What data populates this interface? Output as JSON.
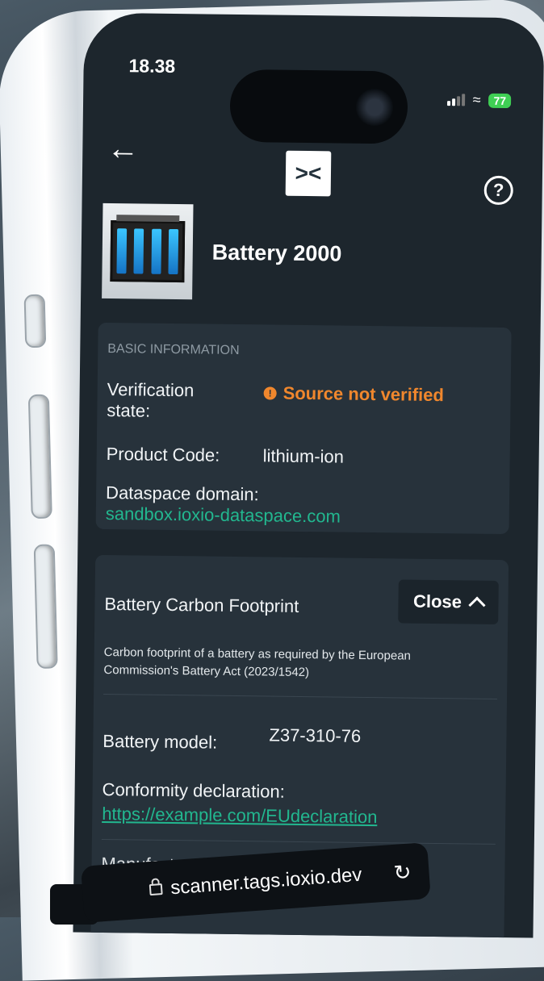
{
  "status": {
    "time": "18.38",
    "battery": "77"
  },
  "header": {
    "back_icon": "arrow-left-icon",
    "logo_text": "><",
    "help_icon": "question-circle-icon"
  },
  "product": {
    "name": "Battery 2000"
  },
  "basic": {
    "section_label": "BASIC INFORMATION",
    "verification_label_1": "Verification",
    "verification_label_2": "state:",
    "verification_value": "Source not verified",
    "product_code_label": "Product Code:",
    "product_code_value": "lithium-ion",
    "dataspace_label": "Dataspace domain:",
    "dataspace_value": "sandbox.ioxio-dataspace.com"
  },
  "carbon": {
    "title": "Battery Carbon Footprint",
    "close_label": "Close",
    "description": "Carbon footprint of a battery as required by the European Commission's Battery Act (2023/1542)",
    "model_label": "Battery model:",
    "model_value": "Z37-310-76",
    "conformity_label": "Conformity declaration:",
    "conformity_link": "https://example.com/EUdeclaration",
    "next_label_partial": "Manufacturer information:"
  },
  "browser": {
    "url": "scanner.tags.ioxio.dev"
  },
  "colors": {
    "accent_link": "#22b78f",
    "warning": "#f0872d",
    "card_bg": "#27323b",
    "screen_bg": "#1d262d"
  }
}
